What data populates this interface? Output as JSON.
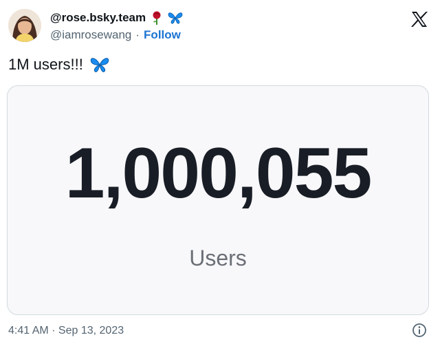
{
  "author": {
    "display_name": "@rose.bsky.team",
    "handle": "@iamrosewang",
    "separator": "·",
    "follow_label": "Follow",
    "name_emojis": [
      "rose-icon",
      "butterfly-icon"
    ]
  },
  "tweet": {
    "text": "1M users!!!",
    "text_emoji": "butterfly-icon"
  },
  "card": {
    "count": "1,000,055",
    "label": "Users"
  },
  "footer": {
    "timestamp": "4:41 AM · Sep 13, 2023"
  },
  "colors": {
    "follow": "#1d74d2",
    "butterfly": "#1a8cf0",
    "rose": "#c0102a",
    "count_text": "#191d26",
    "card_bg": "#f8f8fa"
  },
  "icons": {
    "brand": "x-logo-icon",
    "info": "info-icon"
  }
}
